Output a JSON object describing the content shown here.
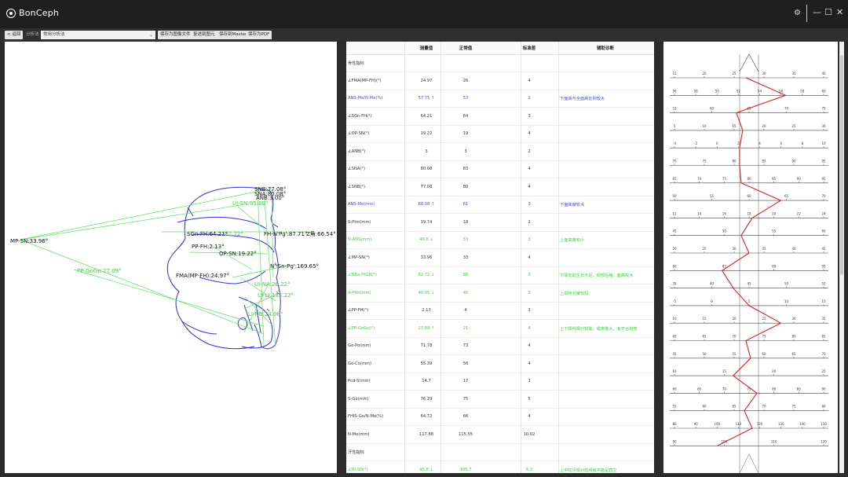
{
  "app": {
    "title": "BonCeph"
  },
  "toolbar": {
    "back_label": "< 返回",
    "analysis_label": "分析法",
    "analysis_value": "常用分析法",
    "btn_save_image": "保存为图像文件",
    "btn_save_measure": "复述到图元",
    "btn_save_master": "保存到Master",
    "btn_save_pdf": "保存为PDF"
  },
  "measure_labels": [
    {
      "text": "SNB:77.08°",
      "color": "#111"
    },
    {
      "text": "SNA:80.08°",
      "color": "#111"
    },
    {
      "text": "ANB:3.00°",
      "color": "#111"
    },
    {
      "text": "UI-SN:95.80°",
      "color": "#3fcf3f"
    },
    {
      "text": "MP-SN:33.96°",
      "color": "#111"
    },
    {
      "text": "SGn-FH:64.21°",
      "color": "#111"
    },
    {
      "text": "/82.72°",
      "color": "#3fcf3f"
    },
    {
      "text": "FH-N'Pg':87.71°",
      "color": "#111"
    },
    {
      "text": "Z角:66.54°",
      "color": "#111"
    },
    {
      "text": "N'-Sn-Pg':169.65°",
      "color": "#111"
    },
    {
      "text": "PP-FH:2.13°",
      "color": "#111"
    },
    {
      "text": "OP-SN:19.22°",
      "color": "#111"
    },
    {
      "text": "PP-GoGn:27.09°",
      "color": "#3fcf3f"
    },
    {
      "text": "FMA(MP-FH):24.97°",
      "color": "#111"
    },
    {
      "text": "UI-NA:26.22°",
      "color": "#3fcf3f"
    },
    {
      "text": "UI-LI:132.22°",
      "color": "#3fcf3f"
    },
    {
      "text": "LI-NB:24.08°",
      "color": "#3fcf3f"
    }
  ],
  "table": {
    "headers": [
      "测量值",
      "正常值",
      "标准差",
      "辅助诊断"
    ],
    "rows": [
      {
        "name": "骨性指标",
        "meas": "",
        "norm": "",
        "sd": "",
        "diag": "",
        "color": "#333"
      },
      {
        "name": "∠FMA(MP-FH)(°)",
        "meas": "24.97",
        "norm": "26",
        "sd": "4",
        "diag": "",
        "color": "#333"
      },
      {
        "name": "ANS-Me/N-Me(%)",
        "meas": "57.75 ↑",
        "norm": "53",
        "sd": "2",
        "diag": "下面高与全面高比例较大",
        "color": "#4a4ae6"
      },
      {
        "name": "∠SGn-FH(°)",
        "meas": "64.21",
        "norm": "64",
        "sd": "3",
        "diag": "",
        "color": "#333"
      },
      {
        "name": "∠OP-SN(°)",
        "meas": "19.22",
        "norm": "19",
        "sd": "4",
        "diag": "",
        "color": "#333"
      },
      {
        "name": "∠ANB(°)",
        "meas": "3",
        "norm": "3",
        "sd": "2",
        "diag": "",
        "color": "#333"
      },
      {
        "name": "∠SNA(°)",
        "meas": "80.08",
        "norm": "83",
        "sd": "4",
        "diag": "",
        "color": "#333"
      },
      {
        "name": "∠SNB(°)",
        "meas": "77.08",
        "norm": "80",
        "sd": "4",
        "diag": "",
        "color": "#333"
      },
      {
        "name": "ANS-Me(mm)",
        "meas": "68.08 ↑",
        "norm": "61",
        "sd": "3",
        "diag": "下面高度较大",
        "color": "#4a4ae6"
      },
      {
        "name": "S-Ptm(mm)",
        "meas": "19.74",
        "norm": "18",
        "sd": "2",
        "diag": "",
        "color": "#333"
      },
      {
        "name": "N-ANS(mm)",
        "meas": "49.6 ↓",
        "norm": "53",
        "sd": "3",
        "diag": "上面高度较小",
        "color": "#3fcf3f"
      },
      {
        "name": "∠MP-SN(°)",
        "meas": "33.96",
        "norm": "33",
        "sd": "4",
        "diag": "",
        "color": "#333"
      },
      {
        "name": "∠NBa-PtGN(°)",
        "meas": "82.72 ↓",
        "norm": "88",
        "sd": "3",
        "diag": "下颌向前生长不足、颏部后缩、面高较大",
        "color": "#3fcf3f"
      },
      {
        "name": "A-Ptm(mm)",
        "meas": "40.95 ↓",
        "norm": "45",
        "sd": "3",
        "diag": "上颌骨长度较短",
        "color": "#3fcf3f"
      },
      {
        "name": "∠PP-FH(°)",
        "meas": "2.13",
        "norm": "4",
        "sd": "3",
        "diag": "",
        "color": "#333"
      },
      {
        "name": "∠PP-GoGn(°)",
        "meas": "27.09 ↑",
        "norm": "21",
        "sd": "4",
        "diag": "上下颌骨相对较陡，或离散大，有开合趋势",
        "color": "#3fcf3f"
      },
      {
        "name": "Go-Po(mm)",
        "meas": "71.78",
        "norm": "73",
        "sd": "4",
        "diag": "",
        "color": "#333"
      },
      {
        "name": "Go-Co(mm)",
        "meas": "55.39",
        "norm": "56",
        "sd": "4",
        "diag": "",
        "color": "#333"
      },
      {
        "name": "Pcd-S(mm)",
        "meas": "14.7",
        "norm": "17",
        "sd": "3",
        "diag": "",
        "color": "#333"
      },
      {
        "name": "S-Go(mm)",
        "meas": "76.29",
        "norm": "75",
        "sd": "5",
        "diag": "",
        "color": "#333"
      },
      {
        "name": "FHIS-Go/N-Me(%)",
        "meas": "64.72",
        "norm": "66",
        "sd": "4",
        "diag": "",
        "color": "#333"
      },
      {
        "name": "N-Me(mm)",
        "meas": "117.88",
        "norm": "115.55",
        "sd": "10.02",
        "diag": "",
        "color": "#333"
      },
      {
        "name": "牙性指标",
        "meas": "",
        "norm": "",
        "sd": "",
        "diag": "",
        "color": "#333"
      },
      {
        "name": "∠UI-SN(°)",
        "meas": "95.8 ↓",
        "norm": "105.7",
        "sd": "6.3",
        "diag": "上中切牙相对前颅底平面呈直立",
        "color": "#3fcf3f"
      }
    ]
  },
  "scale_chart": {
    "rows": [
      {
        "ticks": [
          "15",
          "20",
          "25",
          "30",
          "35",
          "40"
        ],
        "value": 0.48
      },
      {
        "ticks": [
          "56",
          "58",
          "50",
          "52",
          "54",
          "56",
          "58",
          "60"
        ],
        "value": 0.73
      },
      {
        "ticks": [
          "53",
          "60",
          "65",
          "70",
          "75"
        ],
        "value": 0.42
      },
      {
        "ticks": [
          "5",
          "10",
          "15",
          "20",
          "25",
          "30"
        ],
        "value": 0.46
      },
      {
        "ticks": [
          "-4",
          "-2",
          "0",
          "2",
          "4",
          "6",
          "8",
          "10"
        ],
        "value": 0.44
      },
      {
        "ticks": [
          "70",
          "75",
          "80",
          "85",
          "90",
          "95"
        ],
        "value": 0.44
      },
      {
        "ticks": [
          "65",
          "70",
          "75",
          "80",
          "85",
          "90",
          "95"
        ],
        "value": 0.45
      },
      {
        "ticks": [
          "50",
          "55",
          "60",
          "65",
          "70"
        ],
        "value": 0.7
      },
      {
        "ticks": [
          "12",
          "14",
          "16",
          "18",
          "20",
          "22",
          "24"
        ],
        "value": 0.52
      },
      {
        "ticks": [
          "45",
          "50",
          "55",
          "60"
        ],
        "value": 0.45
      },
      {
        "ticks": [
          "20",
          "25",
          "30",
          "35",
          "40",
          "45"
        ],
        "value": 0.5
      },
      {
        "ticks": [
          "80",
          "85",
          "90",
          "95"
        ],
        "value": 0.33
      },
      {
        "ticks": [
          "35",
          "40",
          "45",
          "50",
          "55"
        ],
        "value": 0.4
      },
      {
        "ticks": [
          "-5",
          "0",
          "5",
          "10",
          "15"
        ],
        "value": 0.5
      },
      {
        "ticks": [
          "10",
          "15",
          "20",
          "25",
          "30",
          "35"
        ],
        "value": 0.7
      },
      {
        "ticks": [
          "60",
          "65",
          "70",
          "75",
          "80",
          "85"
        ],
        "value": 0.48
      },
      {
        "ticks": [
          "45",
          "50",
          "55",
          "60",
          "65",
          "70"
        ],
        "value": 0.51
      },
      {
        "ticks": [
          "10",
          "15",
          "20",
          "25"
        ],
        "value": 0.4
      },
      {
        "ticks": [
          "60",
          "65",
          "70",
          "75",
          "80",
          "85",
          "90"
        ],
        "value": 0.55
      },
      {
        "ticks": [
          "55",
          "60",
          "65",
          "70",
          "75",
          "80"
        ],
        "value": 0.47
      },
      {
        "ticks": [
          "80",
          "90",
          "100",
          "110",
          "120",
          "130",
          "140",
          "150"
        ],
        "value": 0.52
      },
      {
        "ticks": [
          "90",
          "100",
          "110",
          "120"
        ],
        "value": 0.3
      }
    ]
  }
}
